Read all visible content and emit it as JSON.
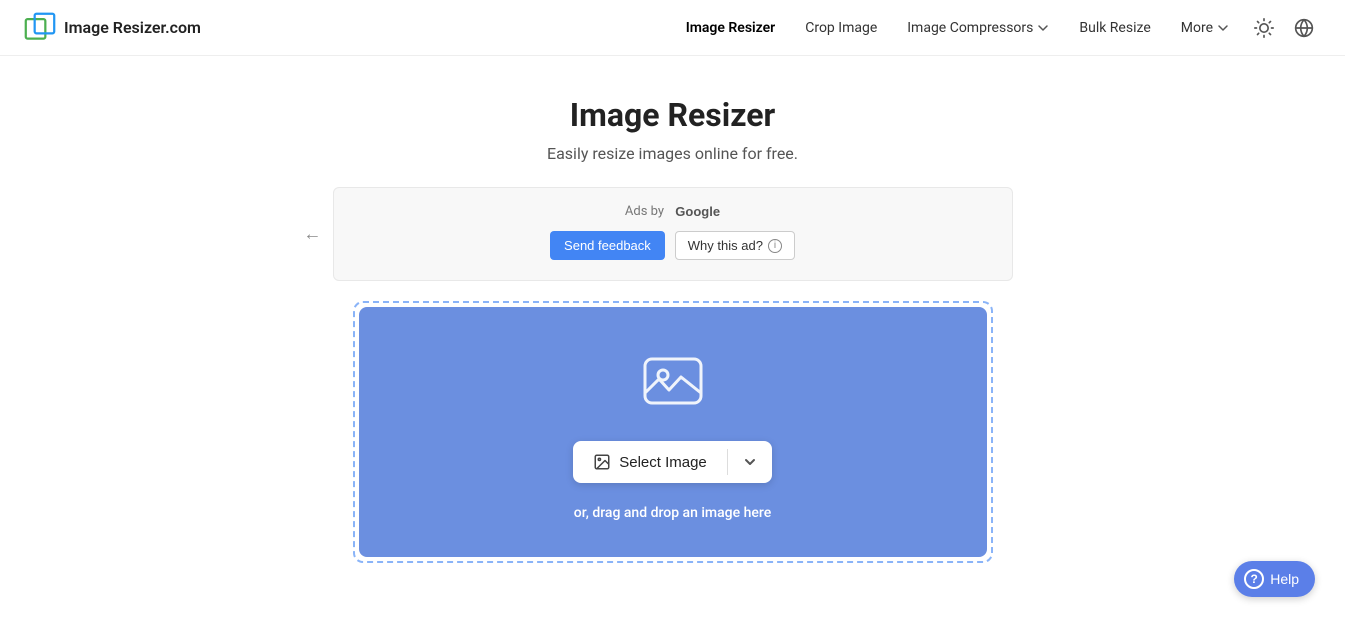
{
  "site": {
    "logo_text": "Image Resizer.com"
  },
  "nav": {
    "links": [
      {
        "label": "Image Resizer",
        "active": true,
        "has_chevron": false
      },
      {
        "label": "Crop Image",
        "active": false,
        "has_chevron": false
      },
      {
        "label": "Image Compressors",
        "active": false,
        "has_chevron": true
      },
      {
        "label": "Bulk Resize",
        "active": false,
        "has_chevron": false
      },
      {
        "label": "More",
        "active": false,
        "has_chevron": true
      }
    ],
    "theme_icon": "☀",
    "globe_icon": "🌐"
  },
  "main": {
    "title": "Image Resizer",
    "subtitle": "Easily resize images online for free."
  },
  "ads": {
    "label": "Ads by",
    "google": "Google",
    "send_feedback": "Send feedback",
    "why_this_ad": "Why this ad?",
    "info_icon": "i"
  },
  "upload": {
    "select_image": "Select Image",
    "drag_drop": "or, drag and drop an image here"
  },
  "help": {
    "label": "Help"
  }
}
